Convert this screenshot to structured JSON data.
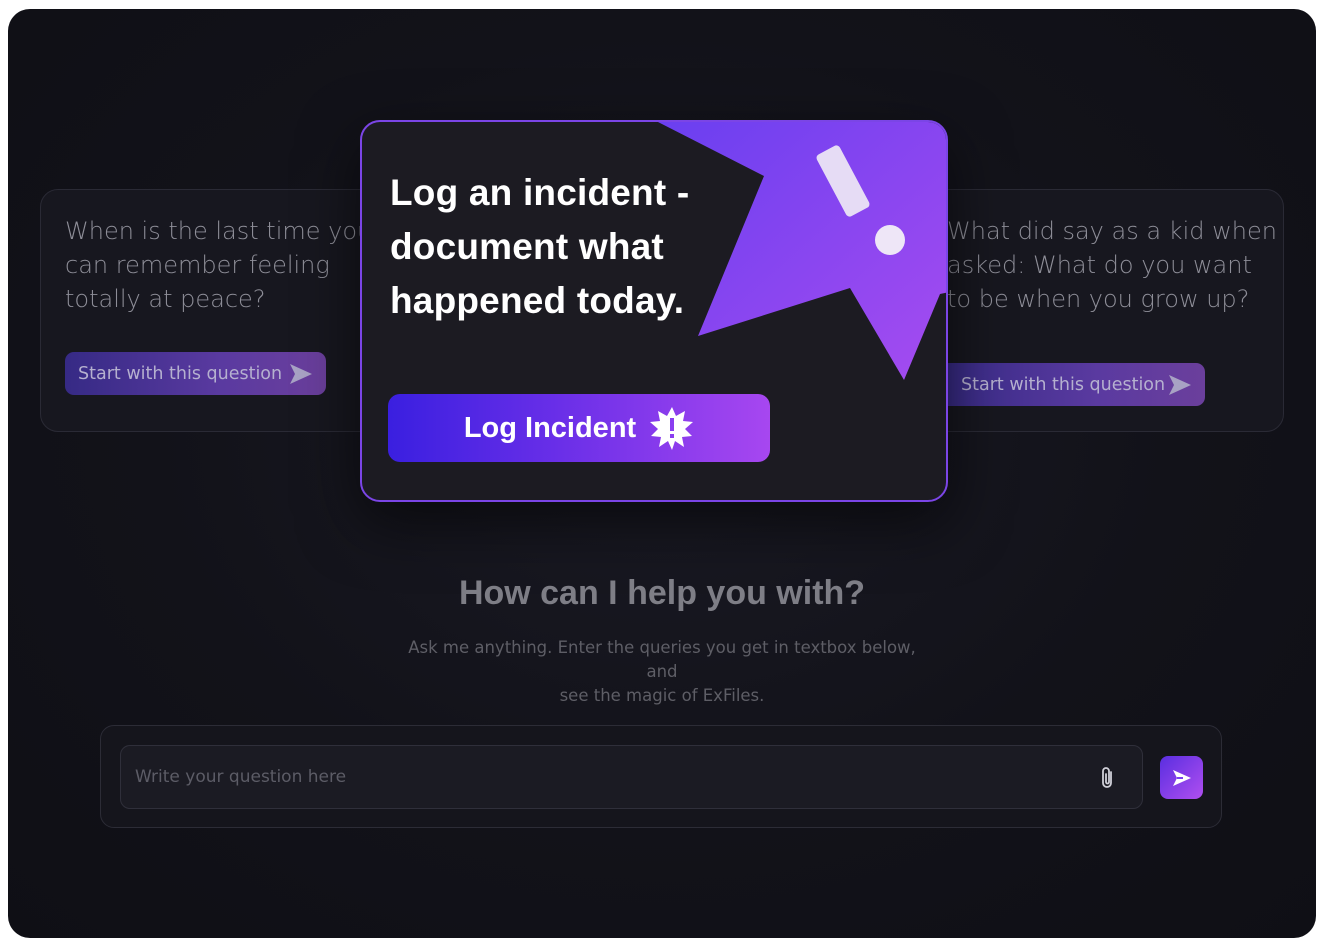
{
  "cards": [
    {
      "question": "When is the last time you can remember feeling totally at peace?",
      "button_label": "Start with this question"
    },
    {
      "question": "What did say as a kid when asked: What do you want to be when you grow up?",
      "button_label": "Start with this question"
    }
  ],
  "modal": {
    "title_lines": [
      "Log an incident -",
      "document what",
      "happened today."
    ],
    "button_label": "Log Incident",
    "accent_colors": [
      "#3a1fe0",
      "#a747f0"
    ]
  },
  "help": {
    "title": "How can I help you with?",
    "subtitle_line1": "Ask me anything. Enter the queries you get in textbox below, and",
    "subtitle_line2": "see the magic of ExFiles."
  },
  "composer": {
    "placeholder": "Write your question here",
    "attach_icon": "paperclip-icon",
    "send_icon": "send-icon"
  }
}
